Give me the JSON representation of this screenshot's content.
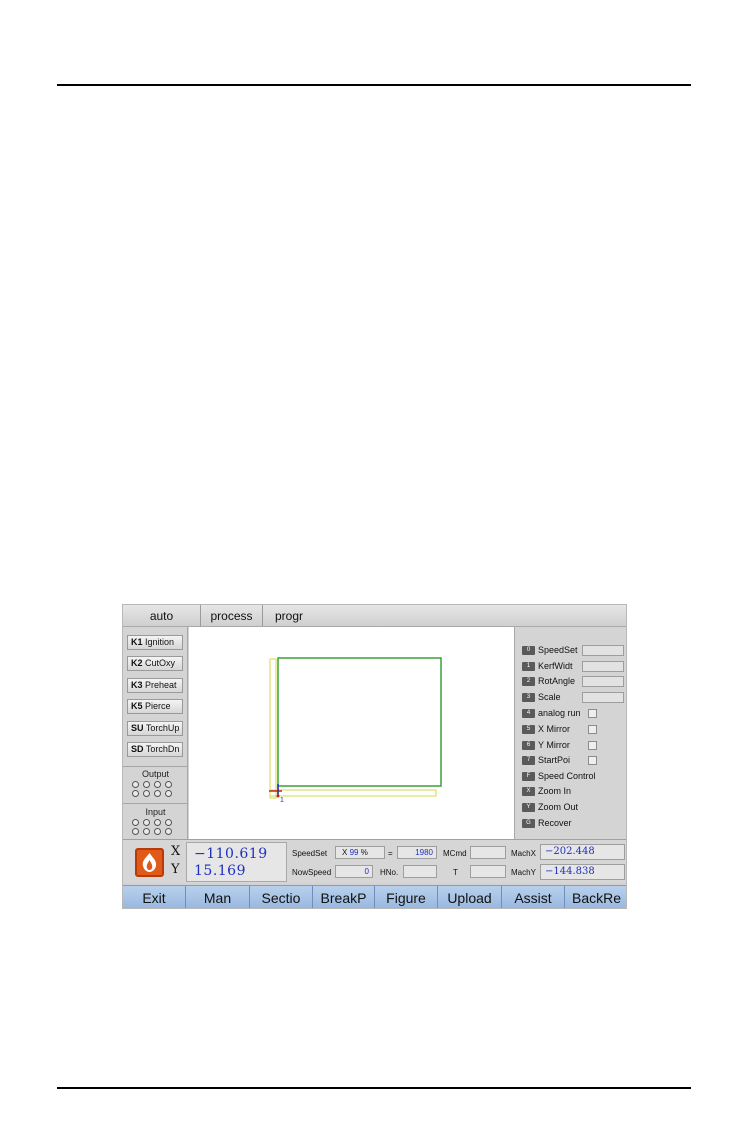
{
  "tabs": [
    "auto",
    "process",
    "progr"
  ],
  "left_keys": [
    {
      "key": "K1",
      "label": "Ignition"
    },
    {
      "key": "K2",
      "label": "CutOxy"
    },
    {
      "key": "K3",
      "label": "Preheat"
    },
    {
      "key": "K5",
      "label": "Pierce"
    },
    {
      "key": "SU",
      "label": "TorchUp"
    },
    {
      "key": "SD",
      "label": "TorchDn"
    }
  ],
  "io": {
    "output_label": "Output",
    "input_label": "Input"
  },
  "right_options": [
    {
      "key": "0",
      "label": "SpeedSet",
      "control": "field"
    },
    {
      "key": "1",
      "label": "KerfWidt",
      "control": "field"
    },
    {
      "key": "2",
      "label": "RotAngle",
      "control": "field"
    },
    {
      "key": "3",
      "label": "Scale",
      "control": "field"
    },
    {
      "key": "4",
      "label": "analog run",
      "control": "check"
    },
    {
      "key": "5",
      "label": "X Mirror",
      "control": "check"
    },
    {
      "key": "6",
      "label": "Y Mirror",
      "control": "check"
    },
    {
      "key": "7",
      "label": "StartPoi",
      "control": "check"
    },
    {
      "key": "F",
      "label": "Speed Control",
      "control": "none"
    },
    {
      "key": "X",
      "label": "Zoom In",
      "control": "none"
    },
    {
      "key": "Y",
      "label": "Zoom Out",
      "control": "none"
    },
    {
      "key": "G",
      "label": "Recover",
      "control": "none"
    }
  ],
  "canvas": {
    "start_marker": "1"
  },
  "status": {
    "x_axis_label": "X",
    "y_axis_label": "Y",
    "x_value": "−110.619",
    "y_value": "15.169",
    "speedset_label": "SpeedSet",
    "speed_x": "X",
    "speed_percent": "99",
    "percent_sign": "%",
    "equals_sign": "=",
    "speed_value": "1980",
    "nowspeed_label": "NowSpeed",
    "nowspeed_value": "0",
    "hno_label": "HNo.",
    "mcmd_label": "MCmd",
    "t_label": "T",
    "machx_label": "MachX",
    "machx_value": "−202.448",
    "machy_label": "MachY",
    "machy_value": "−144.838"
  },
  "function_keys": [
    "Exit",
    "Man",
    "Sectio",
    "BreakP",
    "Figure",
    "Upload",
    "Assist",
    "BackRe"
  ],
  "colors": {
    "path_green": "#3aa03a",
    "outline_yellow": "#d7d84a",
    "coord_blue": "#1f2fbf",
    "fbar_blue": "#a8c4e6",
    "flame_orange": "#e05a1a"
  }
}
